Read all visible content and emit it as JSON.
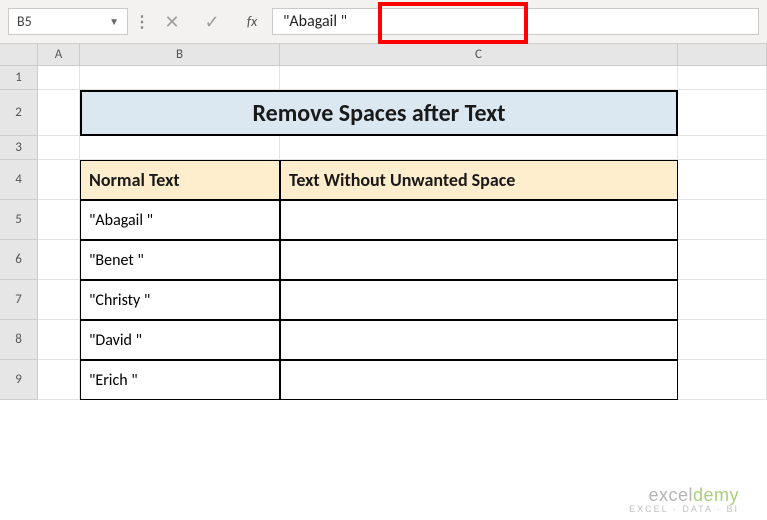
{
  "formula_bar": {
    "name_box": "B5",
    "fx_label": "fx",
    "formula_value": "\"Abagail      \""
  },
  "columns": {
    "A": "A",
    "B": "B",
    "C": "C"
  },
  "rows": [
    "1",
    "2",
    "3",
    "4",
    "5",
    "6",
    "7",
    "8",
    "9"
  ],
  "title": "Remove Spaces after Text",
  "table": {
    "headers": {
      "b": "Normal Text",
      "c": "Text Without Unwanted Space"
    },
    "data": [
      {
        "b": "\"Abagail       \"",
        "c": ""
      },
      {
        "b": "\"Benet      \"",
        "c": ""
      },
      {
        "b": "\"Christy      \"",
        "c": ""
      },
      {
        "b": "\"David     \"",
        "c": ""
      },
      {
        "b": "\"Erich       \"",
        "c": ""
      }
    ]
  },
  "watermark": {
    "brand_a": "excel",
    "brand_b": "demy",
    "tag": "EXCEL · DATA · BI"
  }
}
